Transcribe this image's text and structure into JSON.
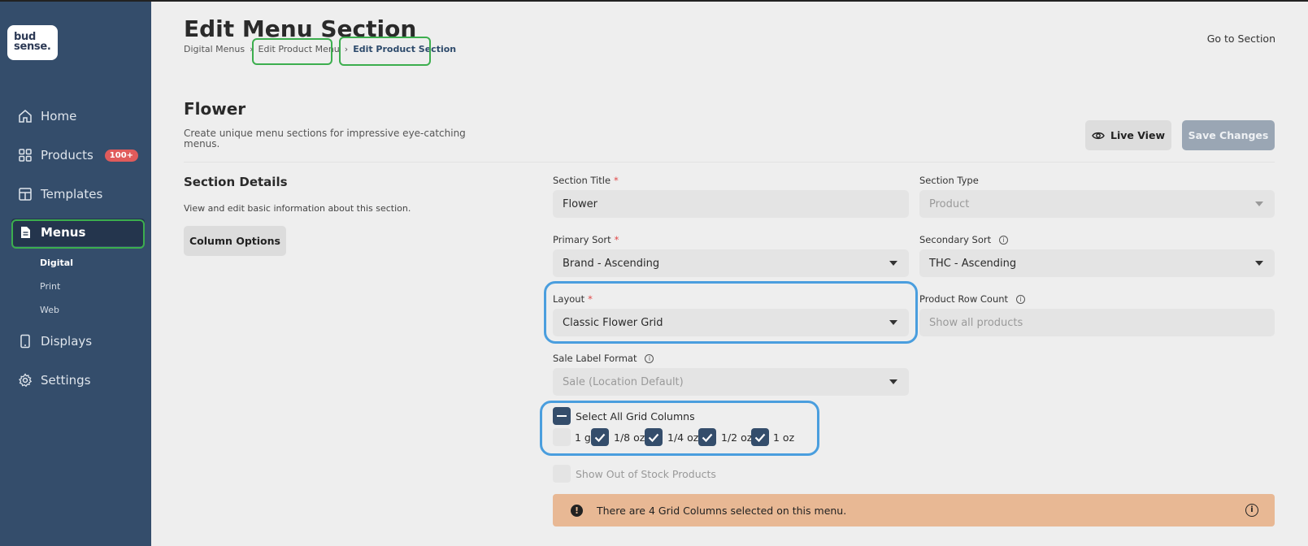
{
  "logo": {
    "line1": "bud",
    "line2": "sense."
  },
  "sidebar": {
    "items": [
      {
        "label": "Home",
        "icon": "home-icon"
      },
      {
        "label": "Products",
        "icon": "grid-icon",
        "badge": "100+"
      },
      {
        "label": "Templates",
        "icon": "template-icon"
      },
      {
        "label": "Menus",
        "icon": "document-icon",
        "active": true
      },
      {
        "label": "Displays",
        "icon": "tablet-icon"
      },
      {
        "label": "Settings",
        "icon": "gear-icon"
      }
    ],
    "sub_items": [
      {
        "label": "Digital",
        "active": true
      },
      {
        "label": "Print"
      },
      {
        "label": "Web"
      }
    ]
  },
  "header": {
    "title": "Edit Menu Section",
    "breadcrumb": [
      "Digital Menus",
      "Edit Product Menu",
      "Edit Product Section"
    ],
    "goto_label": "Go to Section"
  },
  "section": {
    "title": "Flower",
    "description": "Create unique menu sections for impressive eye-catching menus.",
    "live_view_label": "Live View",
    "save_label": "Save Changes"
  },
  "details": {
    "heading": "Section Details",
    "description": "View and edit basic information about this section.",
    "column_options_label": "Column Options"
  },
  "form": {
    "section_title": {
      "label": "Section Title",
      "value": "Flower"
    },
    "section_type": {
      "label": "Section Type",
      "value": "Product"
    },
    "primary_sort": {
      "label": "Primary Sort",
      "value": "Brand - Ascending"
    },
    "secondary_sort": {
      "label": "Secondary Sort",
      "value": "THC - Ascending"
    },
    "layout": {
      "label": "Layout",
      "value": "Classic Flower Grid"
    },
    "product_row_count": {
      "label": "Product Row Count",
      "placeholder": "Show all products"
    },
    "sale_label_format": {
      "label": "Sale Label Format",
      "value": "Sale (Location Default)"
    },
    "select_all_label": "Select All Grid Columns",
    "grid_columns": [
      {
        "label": "1 g",
        "checked": false
      },
      {
        "label": "1/8 oz",
        "checked": true
      },
      {
        "label": "1/4 oz",
        "checked": true
      },
      {
        "label": "1/2 oz",
        "checked": true
      },
      {
        "label": "1 oz",
        "checked": true
      }
    ],
    "show_out_of_stock_label": "Show Out of Stock Products"
  },
  "alert": {
    "text": "There are 4 Grid Columns selected on this menu."
  },
  "colors": {
    "sidebar_bg": "#344d6b",
    "accent": "#344d6b",
    "annotation_green": "#3cae4e",
    "annotation_blue": "#4a9ede",
    "alert_bg": "#e8b894",
    "badge_red": "#e05b5b"
  }
}
